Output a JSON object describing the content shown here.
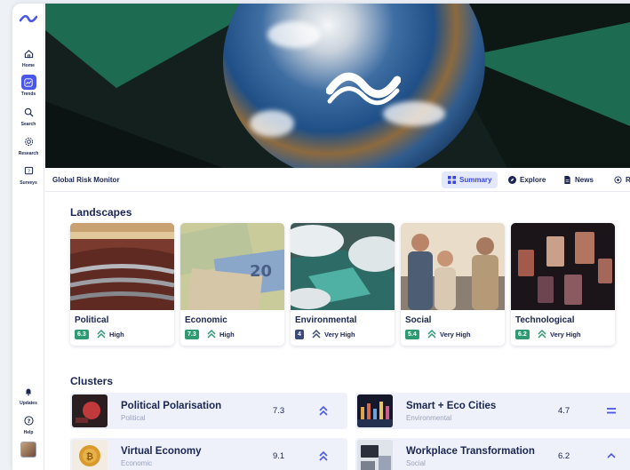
{
  "sidebar": {
    "items": [
      {
        "label": "Home",
        "icon": "home-icon"
      },
      {
        "label": "Trends",
        "icon": "trends-icon"
      },
      {
        "label": "Search",
        "icon": "search-icon"
      },
      {
        "label": "Research",
        "icon": "research-icon"
      },
      {
        "label": "Surveys",
        "icon": "surveys-icon"
      }
    ],
    "bottom": [
      {
        "label": "Updates",
        "icon": "bell-icon"
      },
      {
        "label": "Help",
        "icon": "help-icon"
      }
    ]
  },
  "header": {
    "title": "Global Risk Monitor",
    "tabs": [
      {
        "label": "Summary",
        "icon": "grid-icon",
        "active": true
      },
      {
        "label": "Explore",
        "icon": "compass-icon"
      },
      {
        "label": "News",
        "icon": "document-icon"
      },
      {
        "label": "R",
        "icon": "radar-icon"
      }
    ]
  },
  "landscapes": {
    "title": "Landscapes",
    "items": [
      {
        "name": "Political",
        "score": "6.3",
        "level": "High",
        "color": "#2f9a72"
      },
      {
        "name": "Economic",
        "score": "7.3",
        "level": "High",
        "color": "#2f9a72"
      },
      {
        "name": "Environmental",
        "score": "4",
        "level": "Very High",
        "color": "#3b4a7a"
      },
      {
        "name": "Social",
        "score": "5.4",
        "level": "Very High",
        "color": "#2f9a72"
      },
      {
        "name": "Technological",
        "score": "6.2",
        "level": "Very High",
        "color": "#2f9a72"
      }
    ]
  },
  "clusters": {
    "title": "Clusters",
    "items": [
      {
        "name": "Political Polarisation",
        "category": "Political",
        "value": "7.3",
        "trend": "double-up"
      },
      {
        "name": "Smart + Eco Cities",
        "category": "Environmental",
        "value": "4.7",
        "trend": "equal"
      },
      {
        "name": "Virtual Economy",
        "category": "Economic",
        "value": "9.1",
        "trend": "double-up"
      },
      {
        "name": "Workplace Transformation",
        "category": "Social",
        "value": "6.2",
        "trend": "up"
      }
    ]
  },
  "colors": {
    "accent": "#4a57e8",
    "navy": "#1a2552",
    "green": "#2f9a72",
    "hero_green": "#1d6b50"
  }
}
